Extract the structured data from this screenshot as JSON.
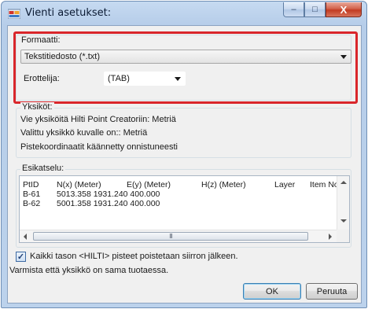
{
  "window": {
    "title": "Vienti asetukset:",
    "controls": {
      "minimize": "–",
      "maximize": "□",
      "close": "X"
    }
  },
  "format": {
    "group_label": "Formaatti:",
    "selected": "Tekstitiedosto (*.txt)",
    "separator_label": "Erottelija:",
    "separator_value": "(TAB)"
  },
  "units": {
    "group_label": "Yksiköt:",
    "lines": [
      "Vie yksiköitä Hilti Point Creatoriin: Metriä",
      "Valittu yksikkö kuvalle on:: Metriä",
      "Pistekoordinaatit käännetty onnistuneesti"
    ]
  },
  "preview": {
    "group_label": "Esikatselu:",
    "columns": [
      "PtID",
      "N(x) (Meter)",
      "E(y) (Meter)",
      "H(z) (Meter)",
      "Layer",
      "Item No"
    ],
    "rows": [
      {
        "id": "B-61",
        "values": "5013.358 1931.240 400.000"
      },
      {
        "id": "B-62",
        "values": "5001.358 1931.240 400.000"
      }
    ],
    "scroll_thumb_grip": "III"
  },
  "options": {
    "delete_checkbox_label": "Kaikki tason <HILTI> pisteet poistetaan siirron jälkeen.",
    "delete_checked": true,
    "note": "Varmista että yksikkö on sama tuotaessa."
  },
  "buttons": {
    "ok": "OK",
    "cancel": "Peruuta"
  },
  "colors": {
    "highlight_frame": "#d9262b",
    "window_frame": "#b6cde9"
  }
}
